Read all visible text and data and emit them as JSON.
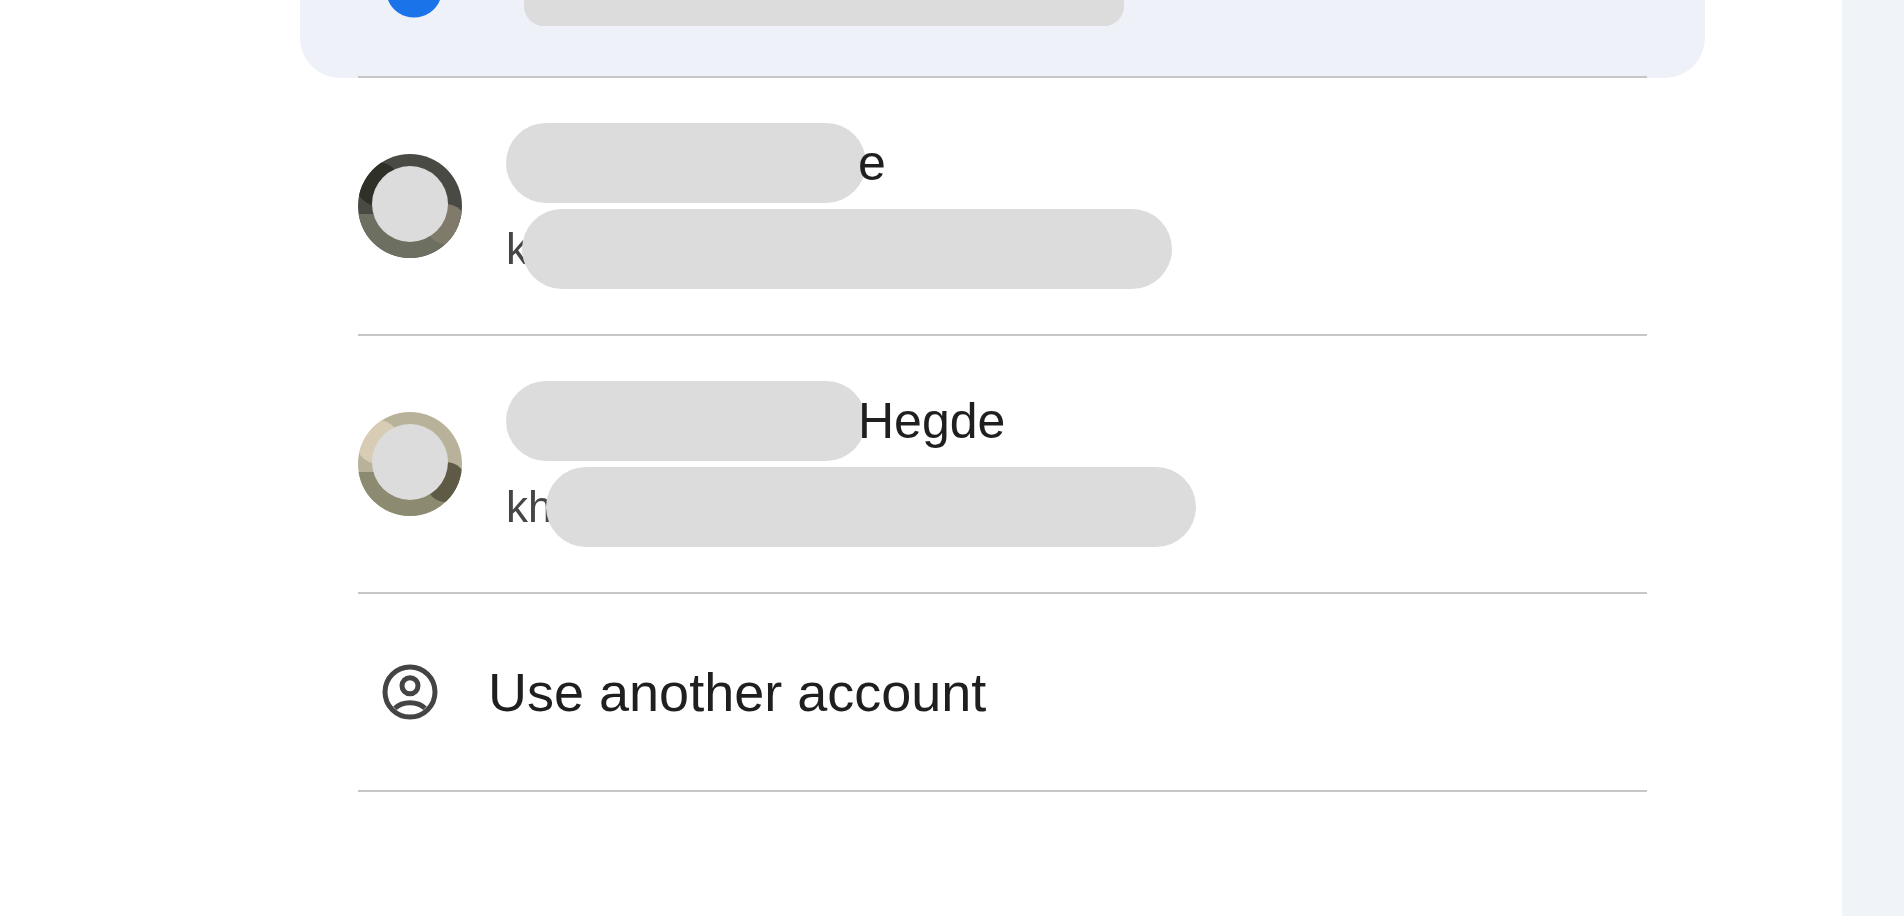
{
  "accounts": [
    {
      "selected": true
    },
    {
      "selected": false,
      "name": "e",
      "email": "k"
    },
    {
      "selected": false,
      "name": "Hegde",
      "email": "kh"
    }
  ],
  "other_account": {
    "label": "Use another account"
  }
}
